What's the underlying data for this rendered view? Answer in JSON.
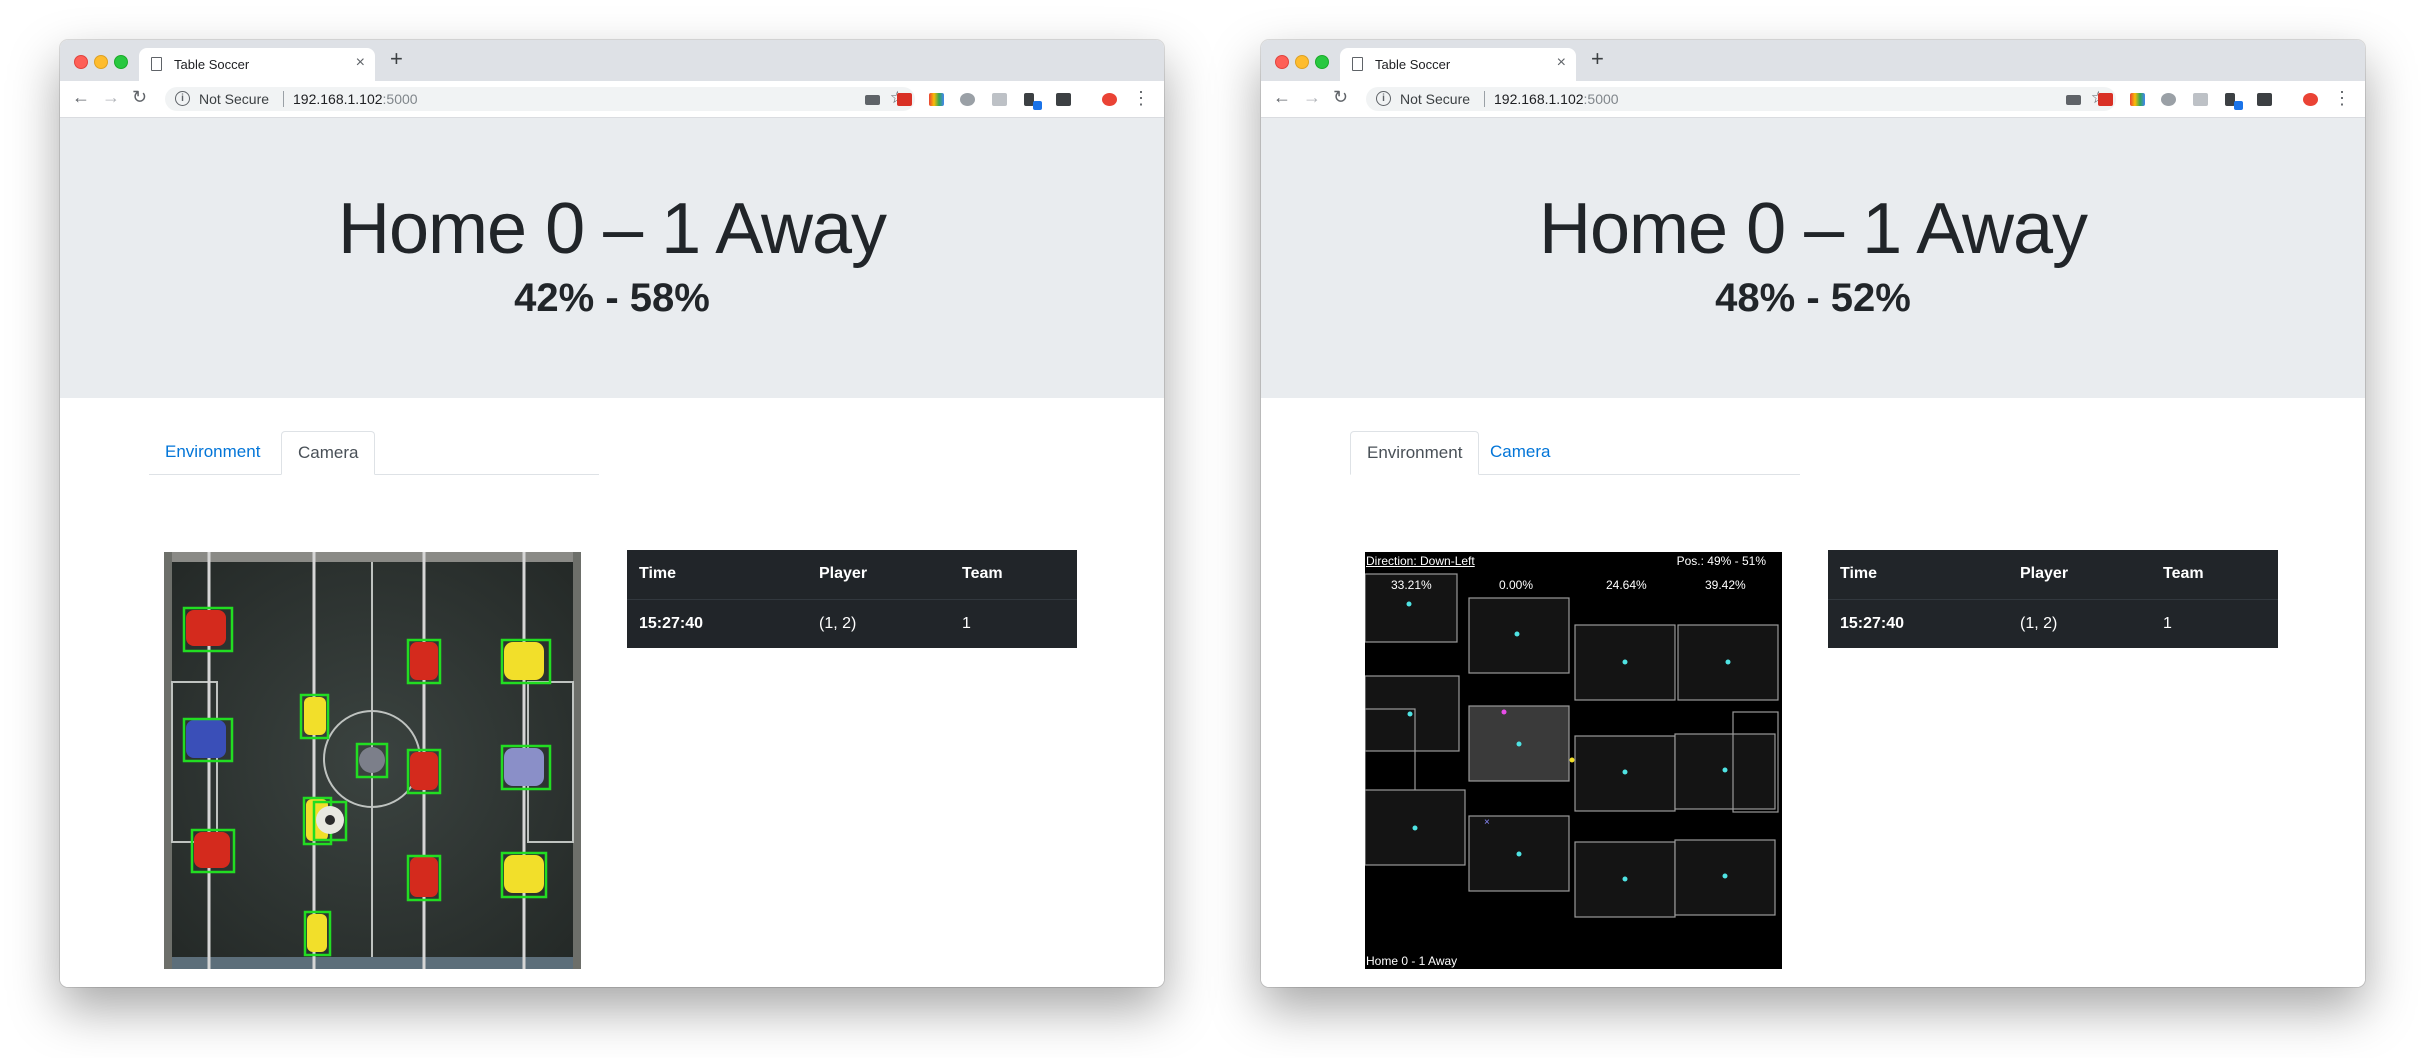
{
  "windows": [
    {
      "tab_title": "Table Soccer",
      "security_label": "Not Secure",
      "url_host": "192.168.1.102",
      "url_port": ":5000",
      "score_text": "Home 0 – 1 Away",
      "possession_text": "42% - 58%",
      "tabs": [
        {
          "label": "Environment",
          "active": false
        },
        {
          "label": "Camera",
          "active": true
        }
      ],
      "table": {
        "headers": [
          "Time",
          "Player",
          "Team"
        ],
        "rows": [
          [
            "15:27:40",
            "(1, 2)",
            "1"
          ]
        ]
      }
    },
    {
      "tab_title": "Table Soccer",
      "security_label": "Not Secure",
      "url_host": "192.168.1.102",
      "url_port": ":5000",
      "score_text": "Home 0 – 1 Away",
      "possession_text": "48% - 52%",
      "tabs": [
        {
          "label": "Environment",
          "active": true
        },
        {
          "label": "Camera",
          "active": false
        }
      ],
      "environment": {
        "direction_text": "Direction: Down-Left",
        "pos_text": "Pos.: 49% - 51%",
        "percentages": [
          "33.21%",
          "0.00%",
          "24.64%",
          "39.42%"
        ],
        "footer_text": "Home 0 - 1 Away",
        "cross_glyph": "×"
      },
      "table": {
        "headers": [
          "Time",
          "Player",
          "Team"
        ],
        "rows": [
          [
            "15:27:40",
            "(1, 2)",
            "1"
          ]
        ]
      }
    }
  ],
  "colors": {
    "jumbotron": "#e9ecef",
    "link": "#0275d8",
    "table_dark": "#212529",
    "detect_box": "#22dd22",
    "home_player": "#d42a1d",
    "away_player": "#f2df2a",
    "blue_player": "#3a4fb8"
  },
  "icons": [
    "page-icon",
    "close-icon",
    "plus-icon",
    "back-arrow-icon",
    "forward-arrow-icon",
    "reload-icon",
    "info-icon",
    "star-icon",
    "menu-dots-icon"
  ]
}
